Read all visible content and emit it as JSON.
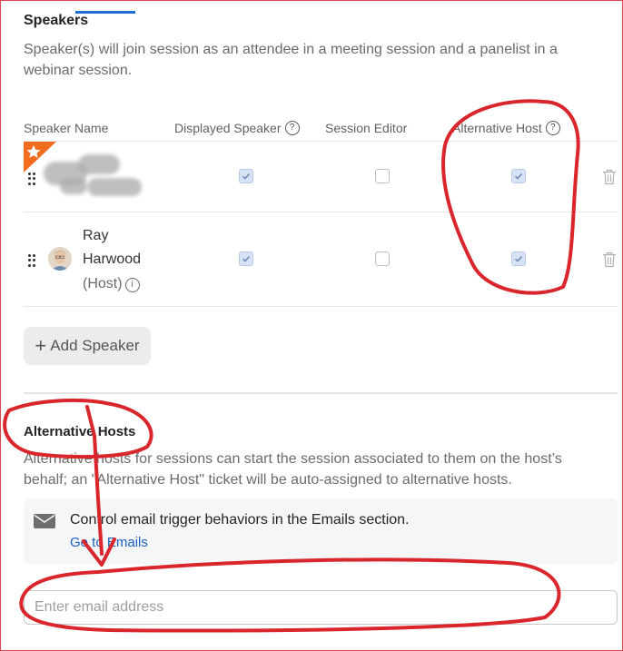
{
  "speakers": {
    "title": "Speakers",
    "description_line1": "Speaker(s) will join session as an attendee in a meeting session and a panelist in a",
    "description_line2": "webinar session.",
    "columns": {
      "speaker_name": "Speaker Name",
      "displayed_speaker": "Displayed Speaker",
      "session_editor": "Session Editor",
      "alternative_host": "Alternative Host"
    },
    "rows": [
      {
        "name": "",
        "displayed_speaker": true,
        "session_editor": false,
        "alternative_host": true
      },
      {
        "name_first": "Ray",
        "name_last": "Harwood",
        "role": "(Host)",
        "displayed_speaker": true,
        "session_editor": false,
        "alternative_host": true
      }
    ],
    "add_button": "Add Speaker"
  },
  "alternative_hosts": {
    "title": "Alternative Hosts",
    "description_line1": "Alternative hosts for sessions can start the session associated to them on the host’s",
    "description_line2": "behalf; an \"Alternative Host\" ticket will be auto-assigned to alternative hosts.",
    "notice_text": "Control email trigger behaviors in the Emails section.",
    "notice_link": "Go to Emails",
    "email_placeholder": "Enter email address"
  },
  "icons": {
    "drag": "drag-handle-icon",
    "trash": "trash-icon",
    "help": "question-circle-icon",
    "info": "info-icon",
    "mail": "mail-icon",
    "star": "star-icon",
    "plus": "plus-icon"
  },
  "colors": {
    "accent": "#1b6fd0",
    "link": "#1b5fbf",
    "checkbox_checked": "#d6e3f7",
    "badge": "#f26c1e",
    "annotation": "#d8262c"
  }
}
